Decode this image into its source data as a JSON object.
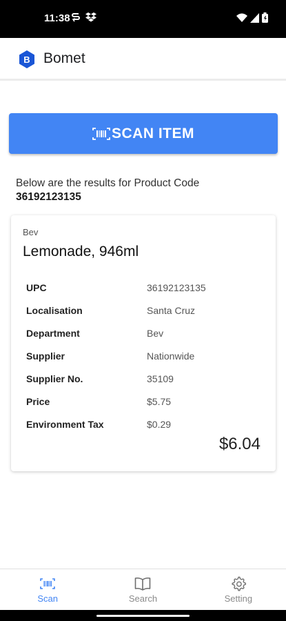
{
  "status_bar": {
    "time": "11:38",
    "icons_left": [
      "sync-icon",
      "dropbox-icon"
    ],
    "icons_right": [
      "wifi-icon",
      "signal-icon",
      "battery-icon"
    ]
  },
  "app_bar": {
    "logo_icon": "bomet-logo-icon",
    "title": "Bomet"
  },
  "scan_button": {
    "icon": "barcode-icon",
    "label": "SCAN ITEM",
    "color": "#4285f4"
  },
  "results": {
    "intro_text": "Below are the results for Product Code",
    "product_code": "36192123135"
  },
  "product_card": {
    "category": "Bev",
    "name": "Lemonade, 946ml",
    "details": [
      {
        "label": "UPC",
        "value": "36192123135"
      },
      {
        "label": "Localisation",
        "value": "Santa Cruz"
      },
      {
        "label": "Department",
        "value": "Bev"
      },
      {
        "label": "Supplier",
        "value": "Nationwide"
      },
      {
        "label": "Supplier No.",
        "value": "35109"
      },
      {
        "label": "Price",
        "value": "$5.75"
      },
      {
        "label": "Environment Tax",
        "value": "$0.29"
      }
    ],
    "total": "$6.04"
  },
  "bottom_nav": {
    "items": [
      {
        "icon": "barcode-icon",
        "label": "Scan",
        "active": true
      },
      {
        "icon": "book-icon",
        "label": "Search",
        "active": false
      },
      {
        "icon": "gear-icon",
        "label": "Setting",
        "active": false
      }
    ],
    "active_color": "#4285f4",
    "inactive_color": "#8a8a8a"
  }
}
